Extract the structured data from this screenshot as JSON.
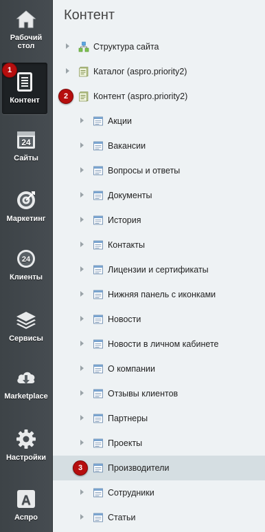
{
  "sidebar": {
    "items": [
      {
        "label": "Рабочий\nстол",
        "icon": "home-icon"
      },
      {
        "label": "Контент",
        "icon": "document-icon",
        "active": true,
        "badge": "1"
      },
      {
        "label": "Сайты",
        "icon": "calendar-24-icon"
      },
      {
        "label": "Маркетинг",
        "icon": "target-icon"
      },
      {
        "label": "Клиенты",
        "icon": "clients-24-icon"
      },
      {
        "label": "Сервисы",
        "icon": "layers-icon"
      },
      {
        "label": "Marketplace",
        "icon": "cloud-download-icon"
      },
      {
        "label": "Настройки",
        "icon": "gear-icon"
      },
      {
        "label": "Аспро",
        "icon": "letter-a-icon"
      }
    ]
  },
  "main": {
    "title": "Контент",
    "tree": [
      {
        "label": "Структура сайта",
        "icon": "site-structure-icon"
      },
      {
        "label": "Каталог (aspro.priority2)",
        "icon": "iblock-type-icon"
      },
      {
        "label": "Контент (aspro.priority2)",
        "icon": "iblock-type-icon",
        "badge": "2"
      },
      {
        "label": "Акции",
        "icon": "iblock-icon"
      },
      {
        "label": "Вакансии",
        "icon": "iblock-icon"
      },
      {
        "label": "Вопросы и ответы",
        "icon": "iblock-icon"
      },
      {
        "label": "Документы",
        "icon": "iblock-icon"
      },
      {
        "label": "История",
        "icon": "iblock-icon"
      },
      {
        "label": "Контакты",
        "icon": "iblock-icon"
      },
      {
        "label": "Лицензии и сертификаты",
        "icon": "iblock-icon"
      },
      {
        "label": "Нижняя панель с иконками",
        "icon": "iblock-icon"
      },
      {
        "label": "Новости",
        "icon": "iblock-icon"
      },
      {
        "label": "Новости в личном кабинете",
        "icon": "iblock-icon"
      },
      {
        "label": "О компании",
        "icon": "iblock-icon"
      },
      {
        "label": "Отзывы клиентов",
        "icon": "iblock-icon"
      },
      {
        "label": "Партнеры",
        "icon": "iblock-icon"
      },
      {
        "label": "Проекты",
        "icon": "iblock-icon"
      },
      {
        "label": "Производители",
        "icon": "iblock-icon",
        "badge": "3",
        "selected": true
      },
      {
        "label": "Сотрудники",
        "icon": "iblock-icon"
      },
      {
        "label": "Статьи",
        "icon": "iblock-icon"
      }
    ]
  },
  "colors": {
    "sidebar_bg": "#444a4f",
    "main_bg": "#eef2f4",
    "selected_row": "#d5dee2",
    "badge": "#b60e0e"
  }
}
